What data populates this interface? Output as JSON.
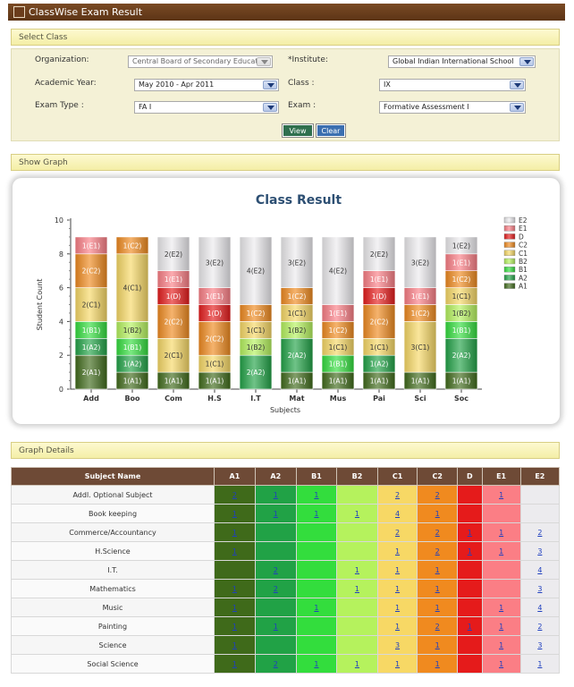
{
  "window": {
    "title": "ClassWise Exam Result"
  },
  "select_class": {
    "heading": "Select Class",
    "organization": {
      "label": "Organization:",
      "value": "Central Board of Secondary Educati"
    },
    "institute": {
      "label": "*Institute:",
      "value": "Global Indian International School"
    },
    "academic_year": {
      "label": "Academic Year:",
      "value": "May 2010 - Apr 2011"
    },
    "class": {
      "label": "Class :",
      "value": "IX"
    },
    "exam_type": {
      "label": "Exam Type :",
      "value": "FA I"
    },
    "exam": {
      "label": "Exam :",
      "value": "Formative Assessment I"
    },
    "view_label": "View",
    "clear_label": "Clear"
  },
  "show_graph": {
    "heading": "Show Graph"
  },
  "chart_data": {
    "type": "bar",
    "stacked": true,
    "title": "Class Result",
    "xlabel": "Subjects",
    "ylabel": "Student Count",
    "ylim": [
      0,
      10
    ],
    "yticks": [
      0,
      2,
      4,
      6,
      8,
      10
    ],
    "categories": [
      "Add",
      "Boo",
      "Com",
      "H.S",
      "I.T",
      "Mat",
      "Mus",
      "Pai",
      "Sci",
      "Soc"
    ],
    "legend_position": "right",
    "series": [
      {
        "name": "A1",
        "color": "#3f6a1a",
        "values": [
          2,
          1,
          1,
          1,
          0,
          1,
          1,
          1,
          1,
          1
        ]
      },
      {
        "name": "A2",
        "color": "#21a246",
        "values": [
          1,
          1,
          0,
          0,
          2,
          2,
          0,
          1,
          0,
          2
        ]
      },
      {
        "name": "B1",
        "color": "#33dd3d",
        "values": [
          1,
          1,
          0,
          0,
          0,
          0,
          1,
          0,
          0,
          1
        ]
      },
      {
        "name": "B2",
        "color": "#b5f25d",
        "values": [
          0,
          1,
          0,
          0,
          1,
          1,
          0,
          0,
          0,
          1
        ]
      },
      {
        "name": "C1",
        "color": "#f7d865",
        "values": [
          2,
          4,
          2,
          1,
          1,
          1,
          1,
          1,
          3,
          1
        ]
      },
      {
        "name": "C2",
        "color": "#f08a1f",
        "values": [
          2,
          1,
          2,
          2,
          1,
          1,
          1,
          2,
          1,
          1
        ]
      },
      {
        "name": "D",
        "color": "#e51b1b",
        "values": [
          0,
          0,
          1,
          1,
          0,
          0,
          0,
          1,
          0,
          0
        ]
      },
      {
        "name": "E1",
        "color": "#fb7e85",
        "values": [
          1,
          0,
          1,
          1,
          0,
          0,
          1,
          1,
          1,
          1
        ]
      },
      {
        "name": "E2",
        "color": "#ecebee",
        "values": [
          0,
          0,
          2,
          3,
          4,
          3,
          4,
          2,
          3,
          1
        ]
      }
    ]
  },
  "graph_details": {
    "heading": "Graph Details",
    "columns": [
      "Subject Name",
      "A1",
      "A2",
      "B1",
      "B2",
      "C1",
      "C2",
      "D",
      "E1",
      "E2"
    ],
    "rows": [
      {
        "subject": "Addl. Optional Subject",
        "cells": [
          "2",
          "1",
          "1",
          "",
          "2",
          "2",
          "",
          "1",
          ""
        ]
      },
      {
        "subject": "Book keeping",
        "cells": [
          "1",
          "1",
          "1",
          "1",
          "4",
          "1",
          "",
          "",
          ""
        ]
      },
      {
        "subject": "Commerce/Accountancy",
        "cells": [
          "1",
          "",
          "",
          "",
          "2",
          "2",
          "1",
          "1",
          "2"
        ]
      },
      {
        "subject": "H.Science",
        "cells": [
          "1",
          "",
          "",
          "",
          "1",
          "2",
          "1",
          "1",
          "3"
        ]
      },
      {
        "subject": "I.T.",
        "cells": [
          "",
          "2",
          "",
          "1",
          "1",
          "1",
          "",
          "",
          "4"
        ]
      },
      {
        "subject": "Mathematics",
        "cells": [
          "1",
          "2",
          "",
          "1",
          "1",
          "1",
          "",
          "",
          "3"
        ]
      },
      {
        "subject": "Music",
        "cells": [
          "1",
          "",
          "1",
          "",
          "1",
          "1",
          "",
          "1",
          "4"
        ]
      },
      {
        "subject": "Painting",
        "cells": [
          "1",
          "1",
          "",
          "",
          "1",
          "2",
          "1",
          "1",
          "2"
        ]
      },
      {
        "subject": "Science",
        "cells": [
          "1",
          "",
          "",
          "",
          "3",
          "1",
          "",
          "1",
          "3"
        ]
      },
      {
        "subject": "Social Science",
        "cells": [
          "1",
          "2",
          "1",
          "1",
          "1",
          "1",
          "",
          "1",
          "1"
        ]
      }
    ]
  }
}
